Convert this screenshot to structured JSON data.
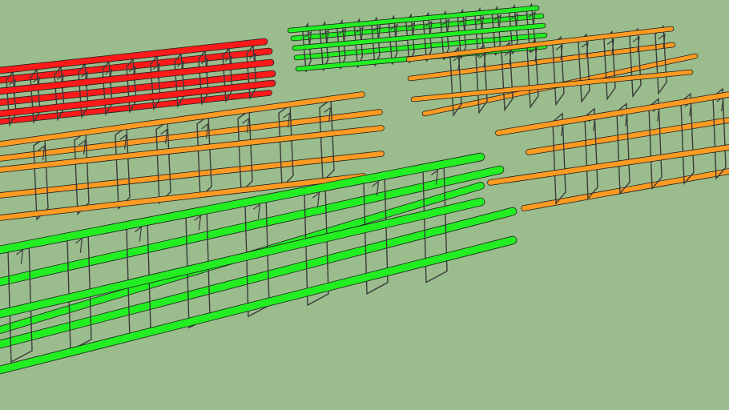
{
  "scene": {
    "background_color": "#9bbd8d",
    "stirrup_color": "#3a3a3a",
    "rebar_outline_color": "#1e1e1e",
    "cages": [
      {
        "id": "red-cage",
        "bar_color": "#ff1a1a"
      },
      {
        "id": "green-cage-top",
        "bar_color": "#22ee22"
      },
      {
        "id": "orange-cage-top-right",
        "bar_color": "#ff9a22"
      },
      {
        "id": "orange-cage-middle",
        "bar_color": "#ff9a22"
      },
      {
        "id": "orange-cage-right",
        "bar_color": "#ff9a22"
      },
      {
        "id": "green-cage-large",
        "bar_color": "#22ee22"
      }
    ]
  }
}
